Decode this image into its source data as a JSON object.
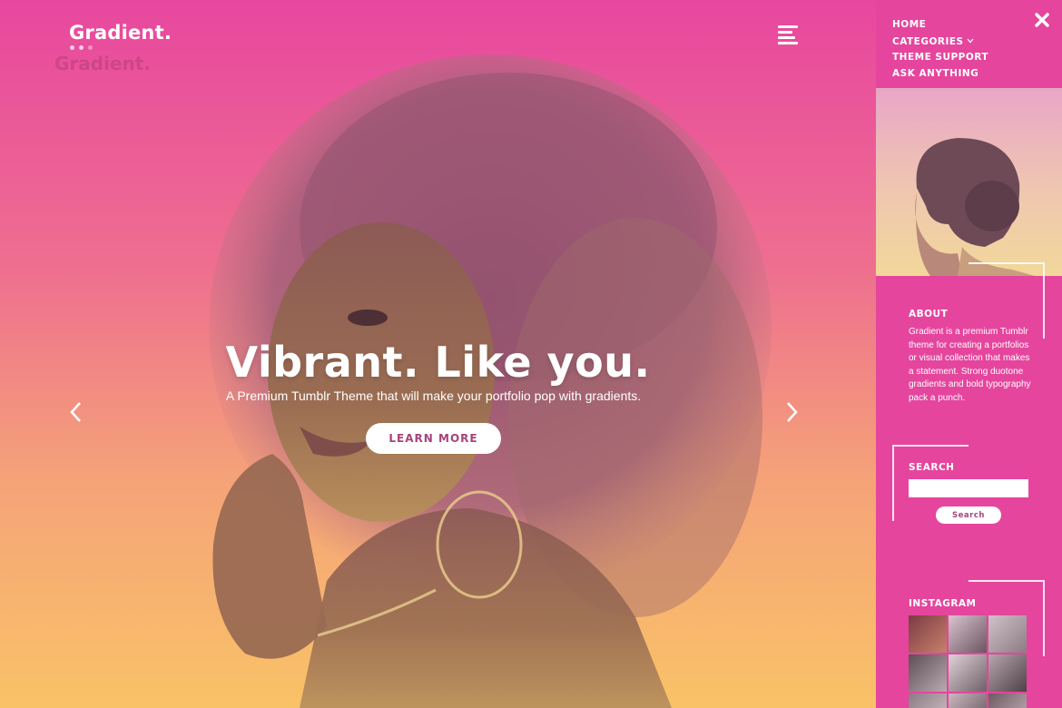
{
  "brand": {
    "logo_text": "Gradient."
  },
  "hero": {
    "headline": "Vibrant. Like you.",
    "subheadline": "A Premium Tumblr Theme that will make your portfolio pop with gradients.",
    "cta_label": "LEARN MORE"
  },
  "icons": {
    "menu": "hamburger-menu-icon",
    "close": "close-icon",
    "prev": "chevron-left-icon",
    "next": "chevron-right-icon",
    "dropdown": "chevron-down-icon"
  },
  "sidebar": {
    "nav": [
      {
        "label": "HOME"
      },
      {
        "label": "CATEGORIES",
        "has_dropdown": true
      },
      {
        "label": "THEME SUPPORT"
      },
      {
        "label": "ASK ANYTHING"
      }
    ],
    "about": {
      "title": "ABOUT",
      "text": "Gradient is a premium Tumblr theme for creating a portfolios or visual collection that makes a statement. Strong duotone gradients and bold typography pack a punch."
    },
    "search": {
      "title": "SEARCH",
      "value": "",
      "button_label": "Search"
    },
    "instagram": {
      "title": "INSTAGRAM",
      "thumbnail_count": 9
    }
  },
  "colors": {
    "sidebar_bg": "#e5459d",
    "gradient_top": "#e8479f",
    "gradient_bottom": "#f9c267",
    "button_text": "#a8437b"
  }
}
